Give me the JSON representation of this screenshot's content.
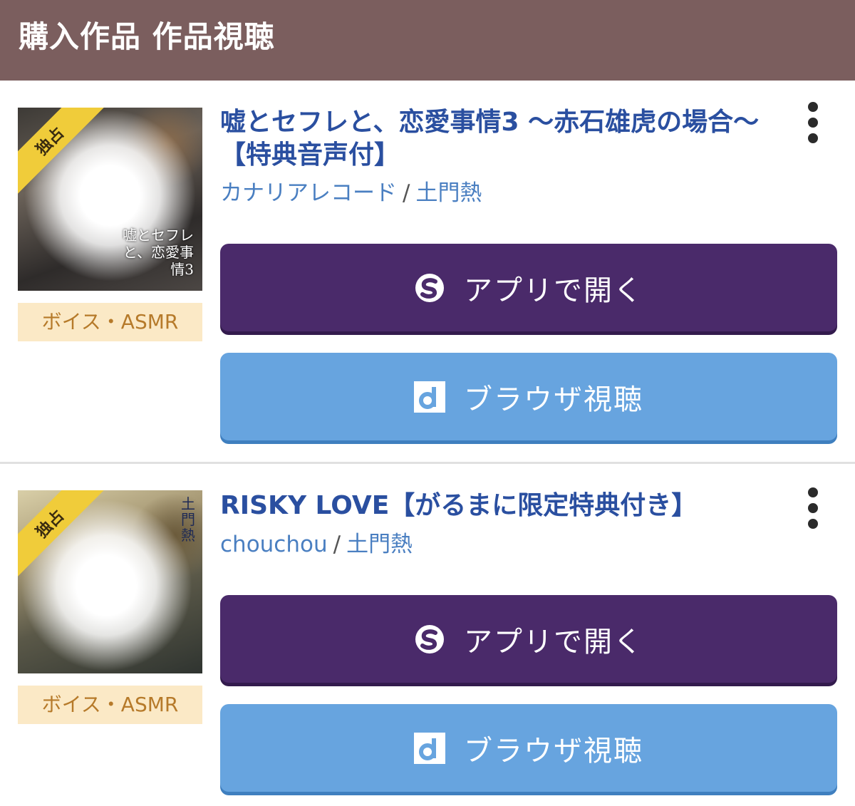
{
  "header": {
    "title": "購入作品 作品視聴"
  },
  "items": [
    {
      "badge": "独占",
      "cover_text": "嘘とセフレと、恋愛事情3",
      "category": "ボイス・ASMR",
      "title": "嘘とセフレと、恋愛事情3 〜赤石雄虎の場合〜【特典音声付】",
      "circle": "カナリアレコード",
      "separator": "/",
      "cv": "土門熱",
      "app_button": "アプリで開く",
      "browser_button": "ブラウザ視聴"
    },
    {
      "badge": "独占",
      "cover_text": "土門熱",
      "category": "ボイス・ASMR",
      "title": "RISKY LOVE【がるまに限定特典付き】",
      "circle": "chouchou",
      "separator": "/",
      "cv": "土門熱",
      "app_button": "アプリで開く",
      "browser_button": "ブラウザ視聴"
    }
  ],
  "colors": {
    "header_bg": "#7b5e5e",
    "title_link": "#2a4fa0",
    "meta_link": "#4a7fc1",
    "app_button": "#4a2a6a",
    "browser_button": "#67a4df",
    "category_bg": "#fbe9c6",
    "category_text": "#b67a2a",
    "exclusive_badge": "#f0cc3a"
  },
  "icons": {
    "app_button": "s-logo-icon",
    "browser_button": "d-logo-icon",
    "menu": "more-vertical-icon"
  }
}
